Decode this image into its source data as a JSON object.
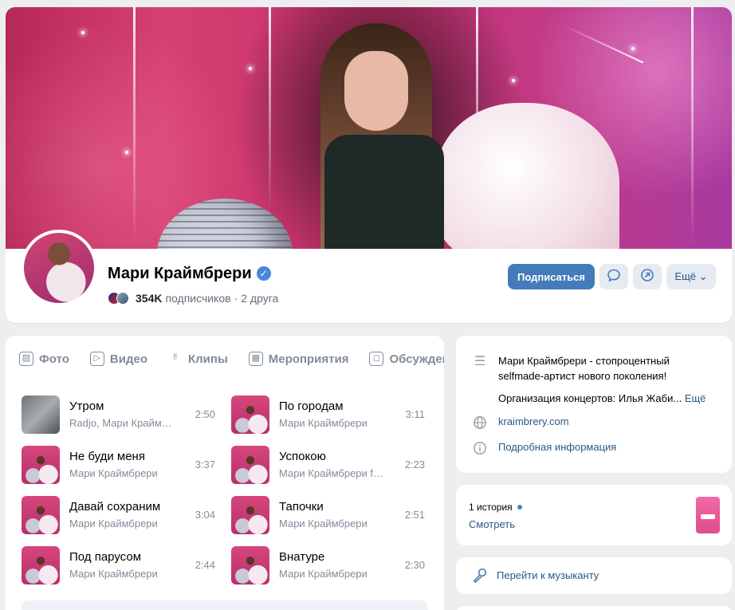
{
  "profile": {
    "name": "Мари Краймбрери",
    "verified_mark": "✓",
    "subscribers_count": "354K",
    "subscribers_label": "подписчиков",
    "separator": "·",
    "friends": "2 друга"
  },
  "actions": {
    "subscribe_label": "Подписаться",
    "message_icon": "message-icon",
    "share_icon": "share-icon",
    "more_label": "Ещё",
    "more_chevron": "⌄"
  },
  "tabs": [
    {
      "label": "Фото",
      "icon": "photo-icon",
      "glyph": "▨"
    },
    {
      "label": "Видео",
      "icon": "video-icon",
      "glyph": "▷"
    },
    {
      "label": "Клипы",
      "icon": "clips-icon",
      "glyph": "✌"
    },
    {
      "label": "Мероприятия",
      "icon": "calendar-icon",
      "glyph": "▦"
    },
    {
      "label": "Обсуждения",
      "icon": "discussion-icon",
      "glyph": "◻"
    }
  ],
  "tracks": [
    {
      "title": "Утром",
      "artist": "Radjo, Мари Краймбрери",
      "duration": "2:50"
    },
    {
      "title": "По городам",
      "artist": "Мари Краймбрери",
      "duration": "3:11"
    },
    {
      "title": "Не буди меня",
      "artist": "Мари Краймбрери",
      "duration": "3:37"
    },
    {
      "title": "Успокою",
      "artist": "Мари Краймбрери feat. ...",
      "duration": "2:23"
    },
    {
      "title": "Давай сохраним",
      "artist": "Мари Краймбрери",
      "duration": "3:04"
    },
    {
      "title": "Тапочки",
      "artist": "Мари Краймбрери",
      "duration": "2:51"
    },
    {
      "title": "Под парусом",
      "artist": "Мари Краймбрери",
      "duration": "2:44"
    },
    {
      "title": "Внатуре",
      "artist": "Мари Краймбрери",
      "duration": "2:30"
    }
  ],
  "info": {
    "description_line1": "Мари Краймбрери - стопроцентный selfmade-артист нового поколения!",
    "description_line2": "Организация концертов: Илья Жаби...",
    "description_more": "Ещё",
    "website": "kraimbrery.com",
    "details_link": "Подробная информация"
  },
  "stories": {
    "count_label": "1 история",
    "watch_label": "Смотреть"
  },
  "musician": {
    "link_label": "Перейти к музыканту"
  },
  "colors": {
    "accent": "#447bba",
    "link": "#2a5885",
    "muted_text": "#818c99",
    "page_bg": "#edeef0"
  }
}
